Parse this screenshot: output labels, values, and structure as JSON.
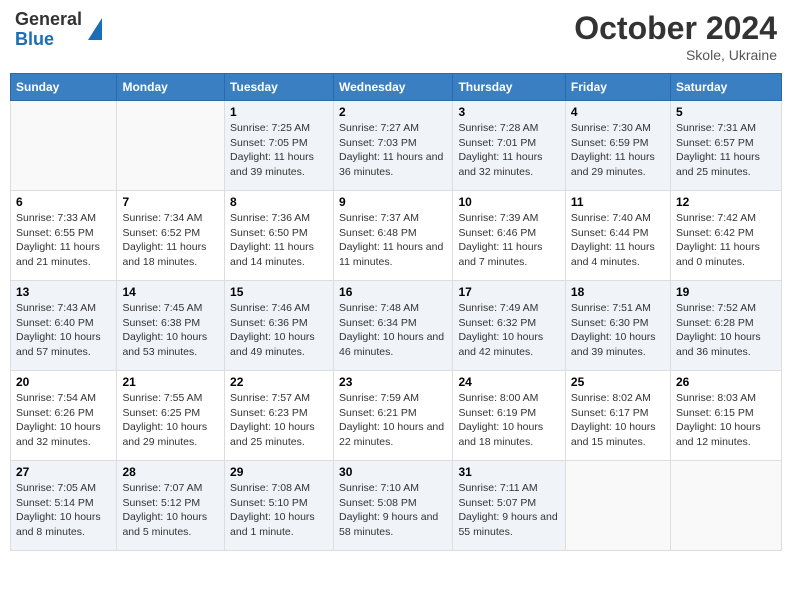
{
  "header": {
    "logo_general": "General",
    "logo_blue": "Blue",
    "title": "October 2024",
    "subtitle": "Skole, Ukraine"
  },
  "weekdays": [
    "Sunday",
    "Monday",
    "Tuesday",
    "Wednesday",
    "Thursday",
    "Friday",
    "Saturday"
  ],
  "weeks": [
    [
      {
        "day": "",
        "sunrise": "",
        "sunset": "",
        "daylight": ""
      },
      {
        "day": "",
        "sunrise": "",
        "sunset": "",
        "daylight": ""
      },
      {
        "day": "1",
        "sunrise": "Sunrise: 7:25 AM",
        "sunset": "Sunset: 7:05 PM",
        "daylight": "Daylight: 11 hours and 39 minutes."
      },
      {
        "day": "2",
        "sunrise": "Sunrise: 7:27 AM",
        "sunset": "Sunset: 7:03 PM",
        "daylight": "Daylight: 11 hours and 36 minutes."
      },
      {
        "day": "3",
        "sunrise": "Sunrise: 7:28 AM",
        "sunset": "Sunset: 7:01 PM",
        "daylight": "Daylight: 11 hours and 32 minutes."
      },
      {
        "day": "4",
        "sunrise": "Sunrise: 7:30 AM",
        "sunset": "Sunset: 6:59 PM",
        "daylight": "Daylight: 11 hours and 29 minutes."
      },
      {
        "day": "5",
        "sunrise": "Sunrise: 7:31 AM",
        "sunset": "Sunset: 6:57 PM",
        "daylight": "Daylight: 11 hours and 25 minutes."
      }
    ],
    [
      {
        "day": "6",
        "sunrise": "Sunrise: 7:33 AM",
        "sunset": "Sunset: 6:55 PM",
        "daylight": "Daylight: 11 hours and 21 minutes."
      },
      {
        "day": "7",
        "sunrise": "Sunrise: 7:34 AM",
        "sunset": "Sunset: 6:52 PM",
        "daylight": "Daylight: 11 hours and 18 minutes."
      },
      {
        "day": "8",
        "sunrise": "Sunrise: 7:36 AM",
        "sunset": "Sunset: 6:50 PM",
        "daylight": "Daylight: 11 hours and 14 minutes."
      },
      {
        "day": "9",
        "sunrise": "Sunrise: 7:37 AM",
        "sunset": "Sunset: 6:48 PM",
        "daylight": "Daylight: 11 hours and 11 minutes."
      },
      {
        "day": "10",
        "sunrise": "Sunrise: 7:39 AM",
        "sunset": "Sunset: 6:46 PM",
        "daylight": "Daylight: 11 hours and 7 minutes."
      },
      {
        "day": "11",
        "sunrise": "Sunrise: 7:40 AM",
        "sunset": "Sunset: 6:44 PM",
        "daylight": "Daylight: 11 hours and 4 minutes."
      },
      {
        "day": "12",
        "sunrise": "Sunrise: 7:42 AM",
        "sunset": "Sunset: 6:42 PM",
        "daylight": "Daylight: 11 hours and 0 minutes."
      }
    ],
    [
      {
        "day": "13",
        "sunrise": "Sunrise: 7:43 AM",
        "sunset": "Sunset: 6:40 PM",
        "daylight": "Daylight: 10 hours and 57 minutes."
      },
      {
        "day": "14",
        "sunrise": "Sunrise: 7:45 AM",
        "sunset": "Sunset: 6:38 PM",
        "daylight": "Daylight: 10 hours and 53 minutes."
      },
      {
        "day": "15",
        "sunrise": "Sunrise: 7:46 AM",
        "sunset": "Sunset: 6:36 PM",
        "daylight": "Daylight: 10 hours and 49 minutes."
      },
      {
        "day": "16",
        "sunrise": "Sunrise: 7:48 AM",
        "sunset": "Sunset: 6:34 PM",
        "daylight": "Daylight: 10 hours and 46 minutes."
      },
      {
        "day": "17",
        "sunrise": "Sunrise: 7:49 AM",
        "sunset": "Sunset: 6:32 PM",
        "daylight": "Daylight: 10 hours and 42 minutes."
      },
      {
        "day": "18",
        "sunrise": "Sunrise: 7:51 AM",
        "sunset": "Sunset: 6:30 PM",
        "daylight": "Daylight: 10 hours and 39 minutes."
      },
      {
        "day": "19",
        "sunrise": "Sunrise: 7:52 AM",
        "sunset": "Sunset: 6:28 PM",
        "daylight": "Daylight: 10 hours and 36 minutes."
      }
    ],
    [
      {
        "day": "20",
        "sunrise": "Sunrise: 7:54 AM",
        "sunset": "Sunset: 6:26 PM",
        "daylight": "Daylight: 10 hours and 32 minutes."
      },
      {
        "day": "21",
        "sunrise": "Sunrise: 7:55 AM",
        "sunset": "Sunset: 6:25 PM",
        "daylight": "Daylight: 10 hours and 29 minutes."
      },
      {
        "day": "22",
        "sunrise": "Sunrise: 7:57 AM",
        "sunset": "Sunset: 6:23 PM",
        "daylight": "Daylight: 10 hours and 25 minutes."
      },
      {
        "day": "23",
        "sunrise": "Sunrise: 7:59 AM",
        "sunset": "Sunset: 6:21 PM",
        "daylight": "Daylight: 10 hours and 22 minutes."
      },
      {
        "day": "24",
        "sunrise": "Sunrise: 8:00 AM",
        "sunset": "Sunset: 6:19 PM",
        "daylight": "Daylight: 10 hours and 18 minutes."
      },
      {
        "day": "25",
        "sunrise": "Sunrise: 8:02 AM",
        "sunset": "Sunset: 6:17 PM",
        "daylight": "Daylight: 10 hours and 15 minutes."
      },
      {
        "day": "26",
        "sunrise": "Sunrise: 8:03 AM",
        "sunset": "Sunset: 6:15 PM",
        "daylight": "Daylight: 10 hours and 12 minutes."
      }
    ],
    [
      {
        "day": "27",
        "sunrise": "Sunrise: 7:05 AM",
        "sunset": "Sunset: 5:14 PM",
        "daylight": "Daylight: 10 hours and 8 minutes."
      },
      {
        "day": "28",
        "sunrise": "Sunrise: 7:07 AM",
        "sunset": "Sunset: 5:12 PM",
        "daylight": "Daylight: 10 hours and 5 minutes."
      },
      {
        "day": "29",
        "sunrise": "Sunrise: 7:08 AM",
        "sunset": "Sunset: 5:10 PM",
        "daylight": "Daylight: 10 hours and 1 minute."
      },
      {
        "day": "30",
        "sunrise": "Sunrise: 7:10 AM",
        "sunset": "Sunset: 5:08 PM",
        "daylight": "Daylight: 9 hours and 58 minutes."
      },
      {
        "day": "31",
        "sunrise": "Sunrise: 7:11 AM",
        "sunset": "Sunset: 5:07 PM",
        "daylight": "Daylight: 9 hours and 55 minutes."
      },
      {
        "day": "",
        "sunrise": "",
        "sunset": "",
        "daylight": ""
      },
      {
        "day": "",
        "sunrise": "",
        "sunset": "",
        "daylight": ""
      }
    ]
  ]
}
